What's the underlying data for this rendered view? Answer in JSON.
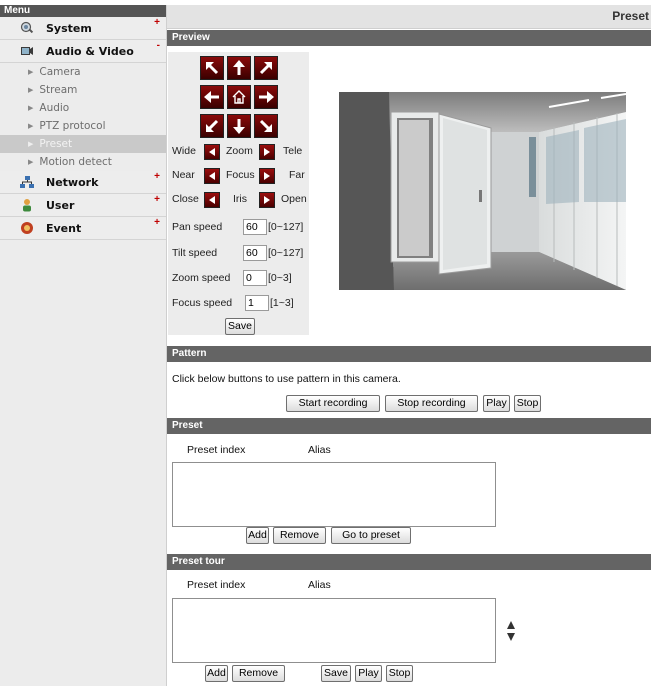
{
  "sidebar": {
    "header": "Menu",
    "categories": [
      {
        "label": "System",
        "sign": "+",
        "icon": "system-icon"
      },
      {
        "label": "Audio & Video",
        "sign": "-",
        "icon": "audio-video-icon"
      },
      {
        "label": "Network",
        "sign": "+",
        "icon": "network-icon"
      },
      {
        "label": "User",
        "sign": "+",
        "icon": "user-icon"
      },
      {
        "label": "Event",
        "sign": "+",
        "icon": "event-icon"
      }
    ],
    "subitems": [
      {
        "label": "Camera"
      },
      {
        "label": "Stream"
      },
      {
        "label": "Audio"
      },
      {
        "label": "PTZ protocol"
      },
      {
        "label": "Preset",
        "active": true
      },
      {
        "label": "Motion detect"
      }
    ]
  },
  "page": {
    "title": "Preset"
  },
  "preview": {
    "header": "Preview",
    "controls": {
      "zoom": {
        "left": "Wide",
        "middle": "Zoom",
        "right": "Tele"
      },
      "focus": {
        "left": "Near",
        "middle": "Focus",
        "right": "Far"
      },
      "iris": {
        "left": "Close",
        "middle": "Iris",
        "right": "Open"
      }
    },
    "speeds": {
      "pan": {
        "label": "Pan speed",
        "value": "60",
        "range": "[0~127]"
      },
      "tilt": {
        "label": "Tilt speed",
        "value": "60",
        "range": "[0~127]"
      },
      "zoom": {
        "label": "Zoom speed",
        "value": "0",
        "range": "[0~3]"
      },
      "focus": {
        "label": "Focus speed",
        "value": "1",
        "range": "[1~3]"
      }
    },
    "save_label": "Save"
  },
  "pattern": {
    "header": "Pattern",
    "description": "Click below buttons to use pattern in this camera.",
    "start_label": "Start recording",
    "stop_recording_label": "Stop recording",
    "play_label": "Play",
    "stop_label": "Stop"
  },
  "preset": {
    "header": "Preset",
    "col_index": "Preset index",
    "col_alias": "Alias",
    "add_label": "Add",
    "remove_label": "Remove",
    "goto_label": "Go to preset"
  },
  "preset_tour": {
    "header": "Preset tour",
    "col_index": "Preset index",
    "col_alias": "Alias",
    "add_label": "Add",
    "remove_label": "Remove",
    "save_label": "Save",
    "play_label": "Play",
    "stop_label": "Stop"
  },
  "colors": {
    "section_header": "#646464",
    "ptz_button": "#8a0a0a",
    "sidebar_bg": "#ececec",
    "active_item": "#c9c9c9"
  }
}
